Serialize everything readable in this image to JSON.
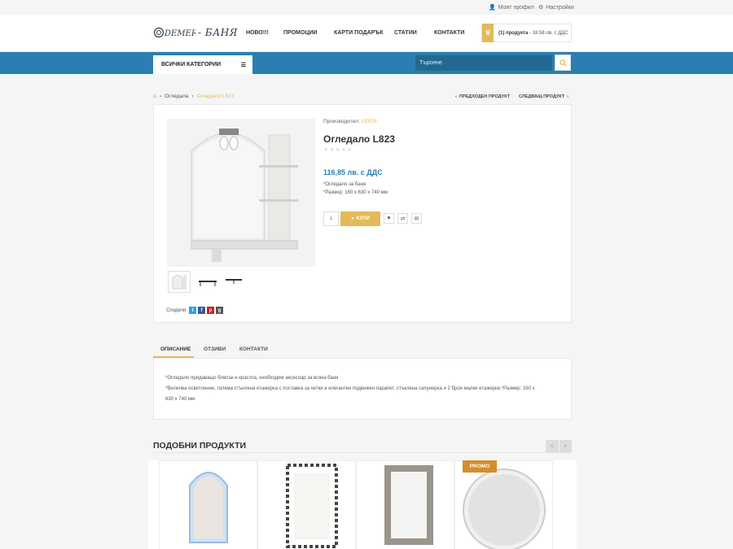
{
  "topbar": {
    "profile": "Моят профил",
    "settings": "Настройки"
  },
  "logo": {
    "mark": "DEMER",
    "suffix": "- БАНЯ"
  },
  "nav": [
    "НОВО!!!",
    "ПРОМОЦИИ",
    "КАРТИ ПОДАРЪК",
    "СТАТИИ",
    "КОНТАКТИ"
  ],
  "cart": {
    "count": "(1) продукта",
    "total": " - 18.58 лв. с ДДС"
  },
  "categories_label": "ВСИЧКИ КАТЕГОРИИ",
  "search": {
    "placeholder": "Търсене"
  },
  "breadcrumb": {
    "level1": "Огледала",
    "current": "Огледало L823"
  },
  "product_nav": {
    "prev": "ПРЕДХОДЕН ПРОДУКТ",
    "next": "СЛЕДВАЩ ПРОДУКТ"
  },
  "product": {
    "manufacturer_label": "Производител:",
    "manufacturer": "LIDER",
    "title": "Огледало L823",
    "price": "116,85 лв. с ДДС",
    "feature1": "*Огледало за баня",
    "feature2": "*Размер: 160 x 630 x 740 мм",
    "qty": "1",
    "buy_label": "КУПИ"
  },
  "share": {
    "label": "Сподели:"
  },
  "tabs": [
    "ОПИСАНИЕ",
    "ОТЗИВИ",
    "КОНТАКТИ"
  ],
  "description": {
    "line1": "*Огледало придаващо блясък и красота, необходим аксесоар за всяка баня",
    "line2": "*Включва осветление, голяма стъклена етажерка с поставка за четки и елегантен подвижен парапет, стъклена сапунерка и 2 броя малки етажерки.*Размер: 160 x",
    "line3": "630 x 740 мм"
  },
  "similar": {
    "title": "ПОДОБНИ ПРОДУКТИ",
    "promo": "PROMO"
  },
  "colors": {
    "accent": "#e4b95a",
    "blue": "#2a7fb0"
  }
}
